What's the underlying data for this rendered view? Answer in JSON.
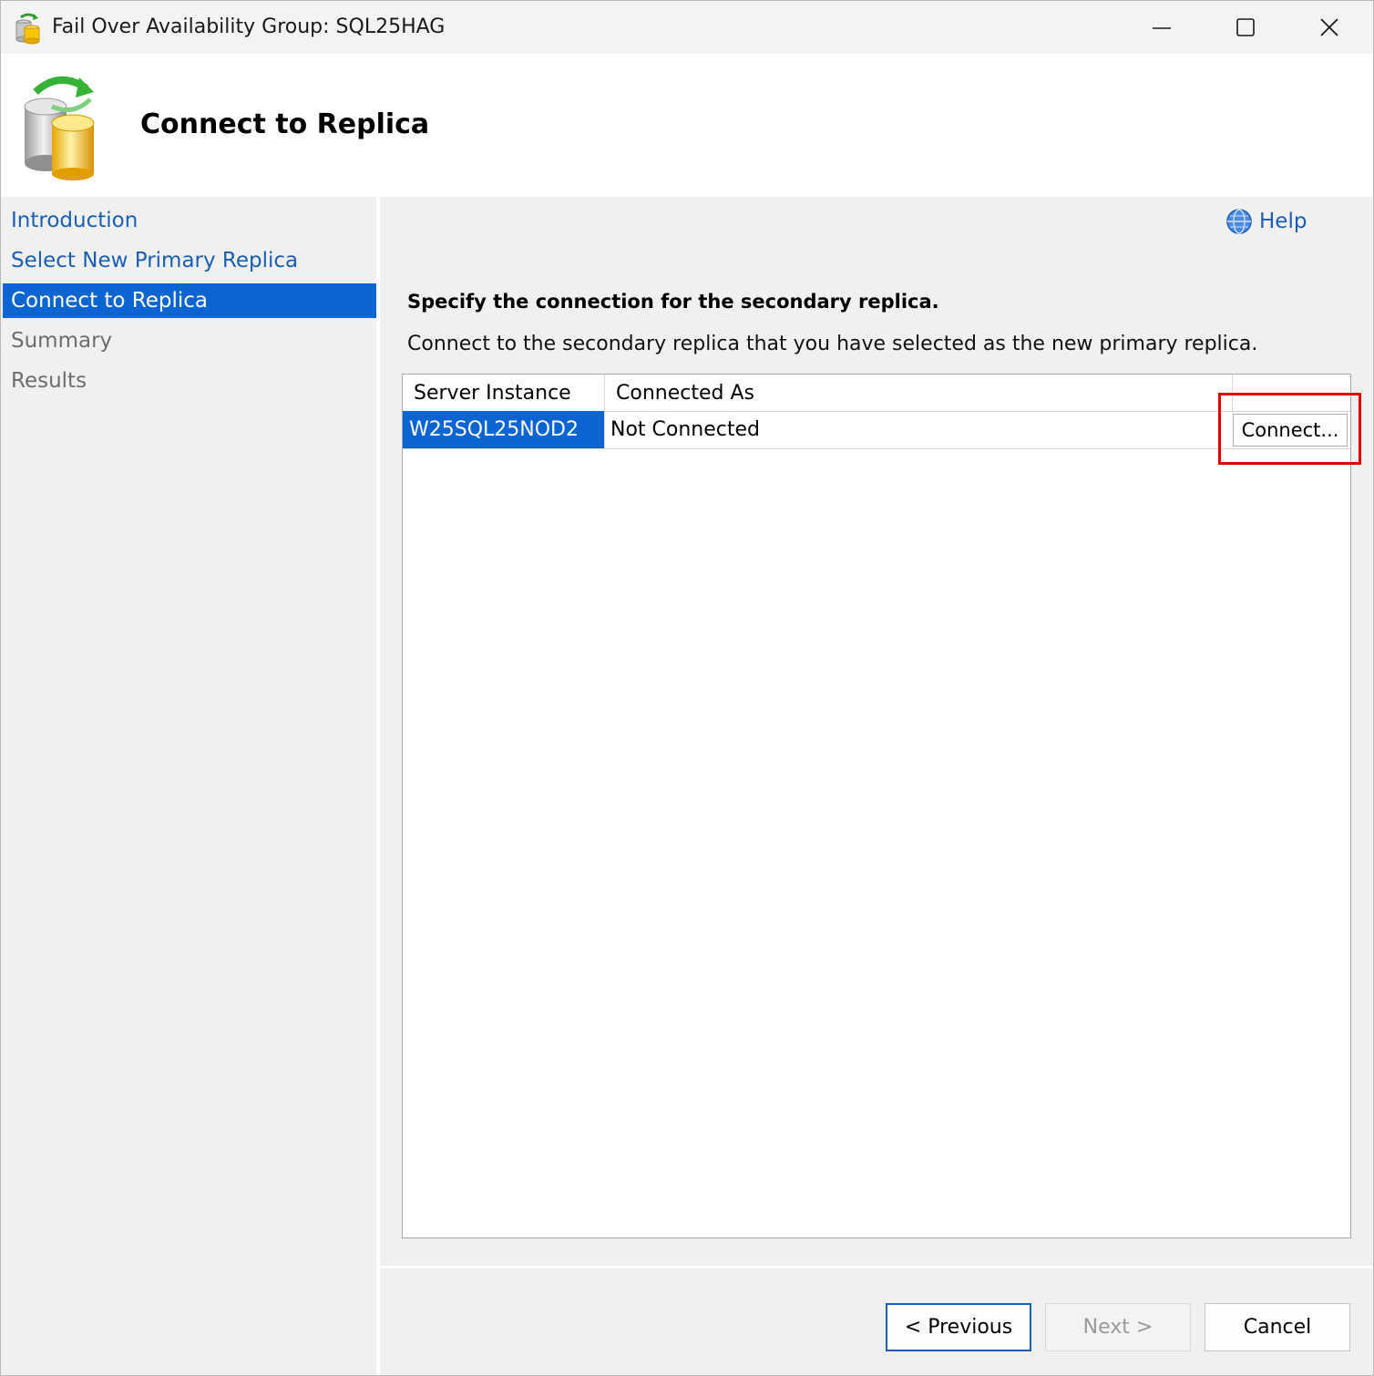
{
  "window": {
    "title": "Fail Over Availability Group: SQL25HAG"
  },
  "banner": {
    "title": "Connect to Replica"
  },
  "nav": {
    "items": [
      {
        "label": "Introduction",
        "state": "link"
      },
      {
        "label": "Select New Primary Replica",
        "state": "link"
      },
      {
        "label": "Connect to Replica",
        "state": "active"
      },
      {
        "label": "Summary",
        "state": "disabled"
      },
      {
        "label": "Results",
        "state": "disabled"
      }
    ]
  },
  "help": {
    "label": "Help",
    "icon": "help-globe-icon"
  },
  "content": {
    "heading": "Specify the connection for the secondary replica.",
    "description": "Connect to the secondary replica that you have selected as the new primary replica."
  },
  "grid": {
    "columns": [
      "Server Instance",
      "Connected As"
    ],
    "rows": [
      {
        "server": "W25SQL25NOD2",
        "connected_as": "Not Connected",
        "action": "Connect..."
      }
    ]
  },
  "footer": {
    "previous": "< Previous",
    "next": "Next >",
    "cancel": "Cancel"
  },
  "colors": {
    "selection": "#0a64d2",
    "link": "#1a5fb4",
    "highlight_box": "#e00000"
  }
}
